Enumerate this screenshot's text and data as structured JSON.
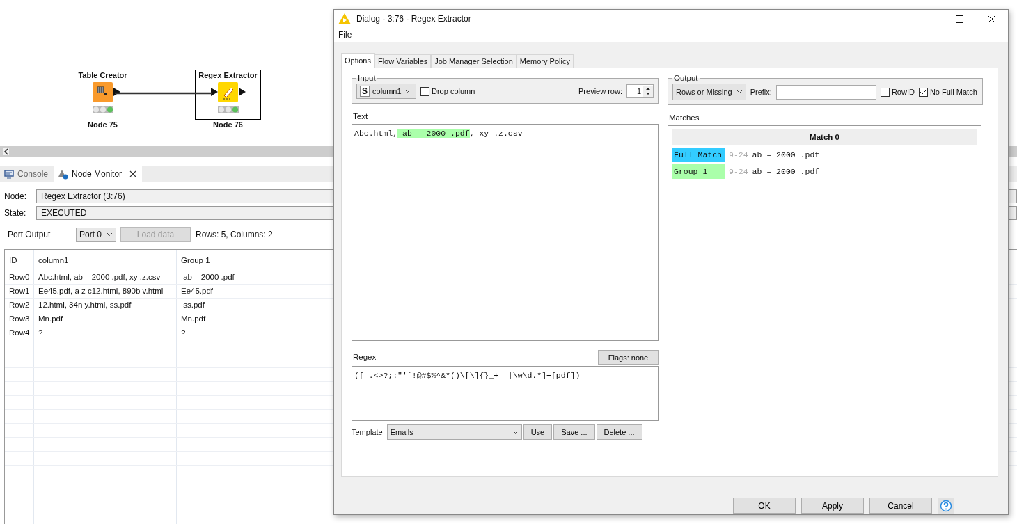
{
  "canvas": {
    "nodes": [
      {
        "title": "Table Creator",
        "label": "Node 75",
        "kind": "source",
        "selected": false
      },
      {
        "title": "Regex Extractor",
        "label": "Node 76",
        "kind": "regex",
        "selected": true
      }
    ]
  },
  "bottom_tabs": [
    {
      "label": "Console",
      "selected": false
    },
    {
      "label": "Node Monitor",
      "selected": true
    }
  ],
  "node_monitor": {
    "node_label": "Node:",
    "node_value": "Regex Extractor  (3:76)",
    "state_label": "State:",
    "state_value": "EXECUTED",
    "port_label": "Port Output",
    "port_select": "Port 0",
    "load_button": {
      "label": "Load data",
      "disabled": true
    },
    "summary": "Rows: 5, Columns: 2"
  },
  "table": {
    "columns": [
      "ID",
      "column1",
      "Group 1"
    ],
    "rows": [
      [
        "Row0",
        "Abc.html, ab – 2000 .pdf, xy .z.csv",
        " ab – 2000 .pdf"
      ],
      [
        "Row1",
        "Ee45.pdf, a z c12.html, 890b v.html",
        "Ee45.pdf"
      ],
      [
        "Row2",
        "12.html, 34n y.html, ss.pdf",
        " ss.pdf"
      ],
      [
        "Row3",
        "Mn.pdf",
        "Mn.pdf"
      ],
      [
        "Row4",
        "?",
        "?"
      ]
    ]
  },
  "dialog": {
    "title": "Dialog - 3:76 - Regex Extractor",
    "menu": [
      "File"
    ],
    "tabs": [
      {
        "label": "Options",
        "selected": true
      },
      {
        "label": "Flow Variables",
        "selected": false
      },
      {
        "label": "Job Manager Selection",
        "selected": false
      },
      {
        "label": "Memory Policy",
        "selected": false
      }
    ],
    "input": {
      "legend": "Input",
      "column_type": "S",
      "column": "column1",
      "drop_column": {
        "label": "Drop column",
        "checked": false
      },
      "preview_label": "Preview row:",
      "preview_value": "1"
    },
    "output": {
      "legend": "Output",
      "mode": "Rows or Missing",
      "prefix_label": "Prefix:",
      "rowid": {
        "label": "RowID",
        "checked": false
      },
      "no_full_match": {
        "label": "No Full Match",
        "checked": true
      }
    },
    "text": {
      "label": "Text",
      "segments": [
        {
          "text": "Abc.html,",
          "highlighted": false
        },
        {
          "text": " ab – 2000 .pdf",
          "highlighted": true
        },
        {
          "text": ", xy .z.csv",
          "highlighted": false
        }
      ]
    },
    "regex": {
      "label": "Regex",
      "flags_button": "Flags: none",
      "value": "([ .<>?;:\"'`!@#$%^&*()\\[\\]{}_+=-|\\w\\d.*]+[pdf])"
    },
    "template": {
      "label": "Template",
      "value": "Emails",
      "buttons": [
        "Use",
        "Save ...",
        "Delete ..."
      ]
    },
    "matches": {
      "label": "Matches",
      "header": "Match 0",
      "items": [
        {
          "label": "Full Match",
          "color": "#33ccff",
          "range": "9-24",
          "value": "ab – 2000 .pdf"
        },
        {
          "label": "Group 1",
          "color": "#aaffaa",
          "range": "9-24",
          "value": "ab – 2000 .pdf"
        }
      ]
    },
    "buttons": [
      "OK",
      "Apply",
      "Cancel"
    ]
  }
}
